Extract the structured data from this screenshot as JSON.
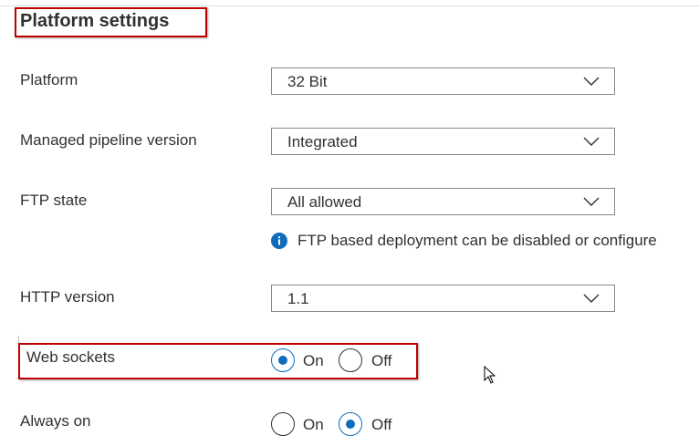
{
  "section": {
    "title": "Platform settings"
  },
  "platform": {
    "label": "Platform",
    "value": "32 Bit"
  },
  "pipeline": {
    "label": "Managed pipeline version",
    "value": "Integrated"
  },
  "ftp": {
    "label": "FTP state",
    "value": "All allowed",
    "info": "FTP based deployment can be disabled or configure"
  },
  "http": {
    "label": "HTTP version",
    "value": "1.1"
  },
  "websockets": {
    "label": "Web sockets",
    "on_label": "On",
    "off_label": "Off",
    "selected": "On"
  },
  "alwayson": {
    "label": "Always on",
    "on_label": "On",
    "off_label": "Off",
    "selected": "Off"
  },
  "colors": {
    "accent": "#0f6cbd",
    "highlight": "#c00000",
    "text": "#323130",
    "border": "#8a8886"
  },
  "icons": {
    "dropdown": "chevron-down-icon",
    "info": "info-icon",
    "pointer": "mouse-cursor-icon"
  }
}
